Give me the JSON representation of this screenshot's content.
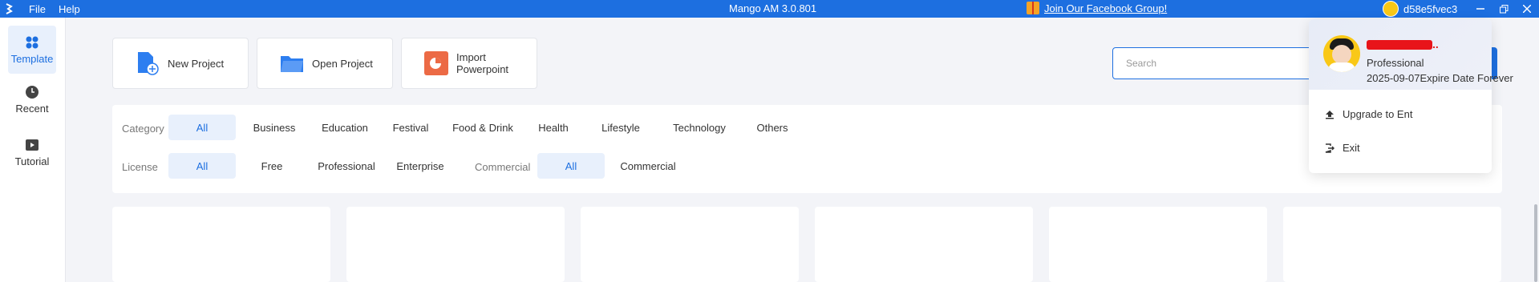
{
  "titlebar": {
    "menu": [
      "File",
      "Help"
    ],
    "title": "Mango AM 3.0.801",
    "facebook_link": "Join Our Facebook Group!",
    "username": "d58e5fvec3"
  },
  "sidebar": {
    "items": [
      {
        "label": "Template",
        "icon": "grid-icon",
        "active": true
      },
      {
        "label": "Recent",
        "icon": "clock-icon",
        "active": false
      },
      {
        "label": "Tutorial",
        "icon": "play-icon",
        "active": false
      }
    ]
  },
  "actions": {
    "new_project": "New Project",
    "open_project": "Open Project",
    "import_powerpoint": "Import Powerpoint"
  },
  "search": {
    "placeholder": "Search"
  },
  "filters": {
    "category_label": "Category",
    "categories": [
      "All",
      "Business",
      "Education",
      "Festival",
      "Food & Drink",
      "Health",
      "Lifestyle",
      "Technology",
      "Others"
    ],
    "license_label": "License",
    "licenses": [
      "All",
      "Free",
      "Professional",
      "Enterprise"
    ],
    "commercial_label": "Commercial",
    "commercial": [
      "All",
      "Commercial"
    ]
  },
  "popup": {
    "plan": "Professional",
    "expire": "2025-09-07Expire Date Forever",
    "upgrade": "Upgrade to Ent",
    "exit": "Exit"
  },
  "colors": {
    "accent": "#1d6fe0",
    "active_chip_bg": "#e8f0fc"
  }
}
